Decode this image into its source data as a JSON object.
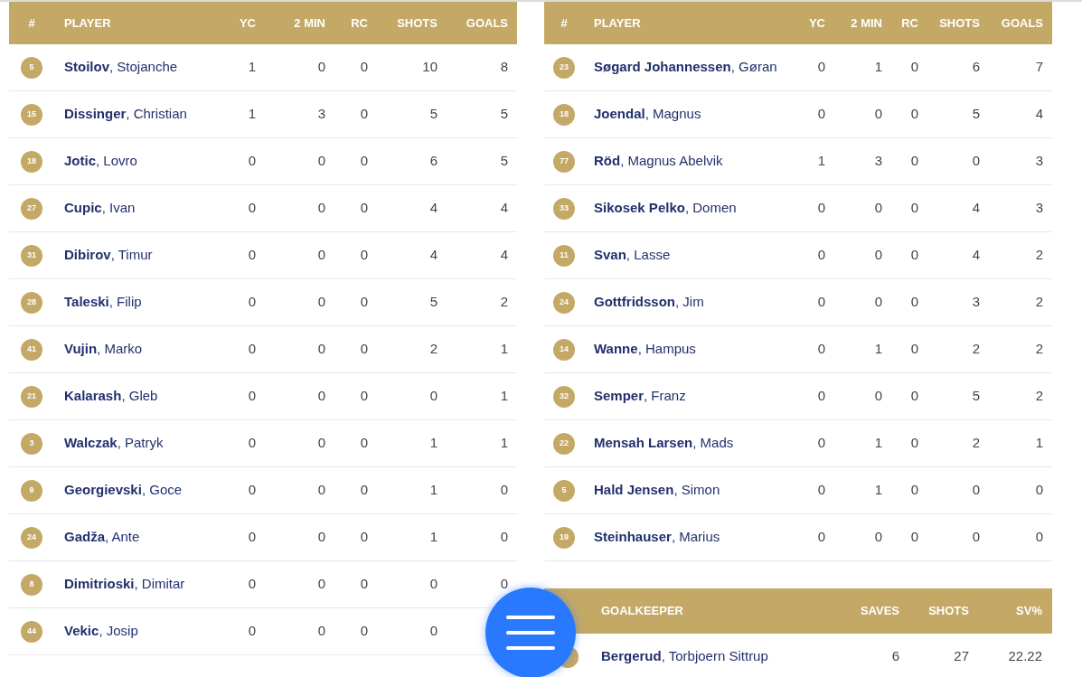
{
  "player_tables": [
    {
      "columns": [
        "#",
        "PLAYER",
        "YC",
        "2 MIN",
        "RC",
        "SHOTS",
        "GOALS"
      ],
      "rows": [
        {
          "number": "5",
          "name": "**Stoilov**, Stojanche",
          "stats": [
            "1",
            "0",
            "0",
            "10",
            "8"
          ]
        },
        {
          "number": "15",
          "name": "**Dissinger**, Christian",
          "stats": [
            "1",
            "3",
            "0",
            "5",
            "5"
          ]
        },
        {
          "number": "18",
          "name": "**Jotic**, Lovro",
          "stats": [
            "0",
            "0",
            "0",
            "6",
            "5"
          ]
        },
        {
          "number": "27",
          "name": "**Cupic**, Ivan",
          "stats": [
            "0",
            "0",
            "0",
            "4",
            "4"
          ]
        },
        {
          "number": "31",
          "name": "**Dibirov**, Timur",
          "stats": [
            "0",
            "0",
            "0",
            "4",
            "4"
          ]
        },
        {
          "number": "28",
          "name": "**Taleski**, Filip",
          "stats": [
            "0",
            "0",
            "0",
            "5",
            "2"
          ]
        },
        {
          "number": "41",
          "name": "**Vujin**, Marko",
          "stats": [
            "0",
            "0",
            "0",
            "2",
            "1"
          ]
        },
        {
          "number": "21",
          "name": "**Kalarash**, Gleb",
          "stats": [
            "0",
            "0",
            "0",
            "0",
            "1"
          ]
        },
        {
          "number": "3",
          "name": "**Walczak**, Patryk",
          "stats": [
            "0",
            "0",
            "0",
            "1",
            "1"
          ]
        },
        {
          "number": "9",
          "name": "**Georgievski**, Goce",
          "stats": [
            "0",
            "0",
            "0",
            "1",
            "0"
          ]
        },
        {
          "number": "24",
          "name": "**Gadža**, Ante",
          "stats": [
            "0",
            "0",
            "0",
            "1",
            "0"
          ]
        },
        {
          "number": "8",
          "name": "**Dimitrioski**, Dimitar",
          "stats": [
            "0",
            "0",
            "0",
            "0",
            "0"
          ]
        },
        {
          "number": "44",
          "name": "**Vekic**, Josip",
          "stats": [
            "0",
            "0",
            "0",
            "0"
          ]
        }
      ]
    },
    {
      "columns": [
        "#",
        "PLAYER",
        "YC",
        "2 MIN",
        "RC",
        "SHOTS",
        "GOALS"
      ],
      "rows": [
        {
          "number": "23",
          "name": "**Søgard Johannessen**, Gøran",
          "stats": [
            "0",
            "1",
            "0",
            "6",
            "7"
          ]
        },
        {
          "number": "18",
          "name": "**Joendal**, Magnus",
          "stats": [
            "0",
            "0",
            "0",
            "5",
            "4"
          ]
        },
        {
          "number": "77",
          "name": "**Röd**, Magnus Abelvik",
          "stats": [
            "1",
            "3",
            "0",
            "0",
            "3"
          ]
        },
        {
          "number": "33",
          "name": "**Sikosek Pelko**, Domen",
          "stats": [
            "0",
            "0",
            "0",
            "4",
            "3"
          ]
        },
        {
          "number": "11",
          "name": "**Svan**, Lasse",
          "stats": [
            "0",
            "0",
            "0",
            "4",
            "2"
          ]
        },
        {
          "number": "24",
          "name": "**Gottfridsson**, Jim",
          "stats": [
            "0",
            "0",
            "0",
            "3",
            "2"
          ]
        },
        {
          "number": "14",
          "name": "**Wanne**, Hampus",
          "stats": [
            "0",
            "1",
            "0",
            "2",
            "2"
          ]
        },
        {
          "number": "32",
          "name": "**Semper**, Franz",
          "stats": [
            "0",
            "0",
            "0",
            "5",
            "2"
          ]
        },
        {
          "number": "22",
          "name": "**Mensah Larsen**, Mads",
          "stats": [
            "0",
            "1",
            "0",
            "2",
            "1"
          ]
        },
        {
          "number": "5",
          "name": "**Hald Jensen**, Simon",
          "stats": [
            "0",
            "1",
            "0",
            "0",
            "0"
          ]
        },
        {
          "number": "19",
          "name": "**Steinhauser**, Marius",
          "stats": [
            "0",
            "0",
            "0",
            "0",
            "0"
          ]
        }
      ]
    }
  ],
  "goalkeeper_table": {
    "columns": [
      "GOALKEEPER",
      "SAVES",
      "SHOTS",
      "SV%"
    ],
    "rows": [
      {
        "name": "**Bergerud**, Torbjoern Sittrup",
        "stats": [
          "6",
          "27",
          "22.22"
        ]
      }
    ]
  }
}
